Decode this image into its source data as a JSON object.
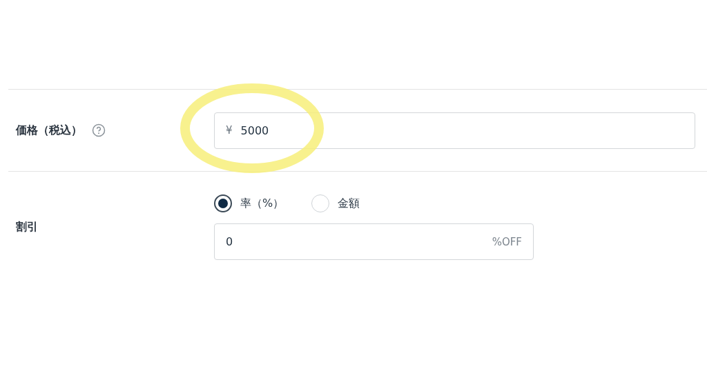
{
  "price": {
    "label": "価格（税込）",
    "prefix": "¥",
    "value": "5000"
  },
  "discount": {
    "label": "割引",
    "options": [
      {
        "label": "率（%）",
        "selected": true
      },
      {
        "label": "金額",
        "selected": false
      }
    ],
    "value": "0",
    "suffix": "%OFF"
  },
  "annotation": {
    "kind": "highlight"
  }
}
